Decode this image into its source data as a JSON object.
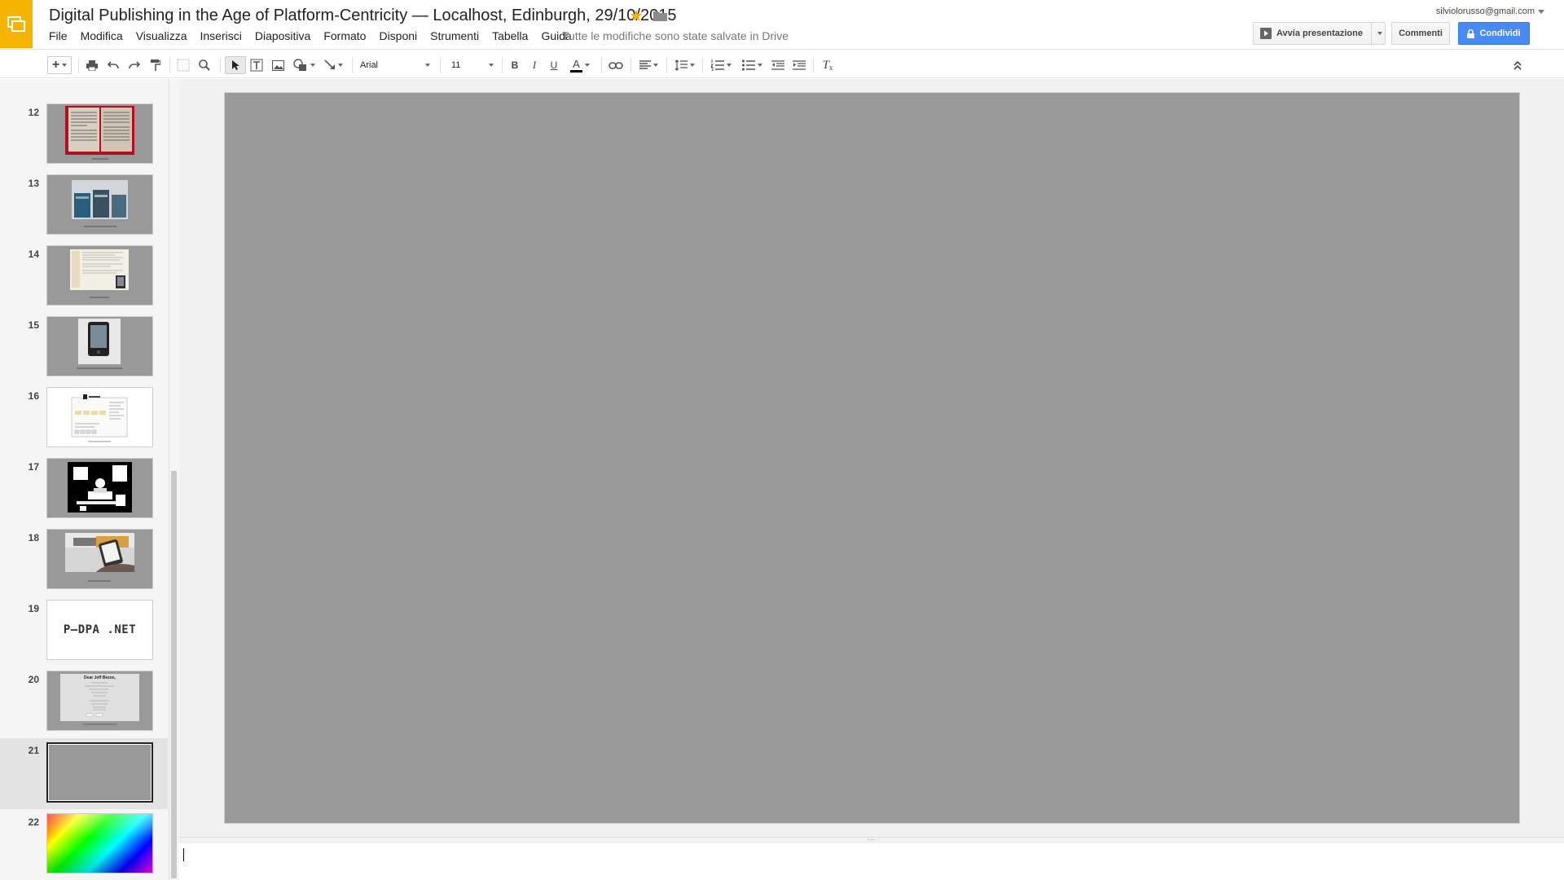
{
  "header": {
    "title": "Digital Publishing in the Age of Platform-Centricity — Localhost, Edinburgh, 29/10/2015",
    "save_status": "Tutte le modifiche sono state salvate in Drive",
    "account": "silviolorusso@gmail.com",
    "present_label": "Avvia presentazione",
    "comments_label": "Commenti",
    "share_label": "Condividi",
    "star_icon": "star-icon",
    "folder_icon": "folder-icon"
  },
  "menu": [
    "File",
    "Modifica",
    "Visualizza",
    "Inserisci",
    "Diapositiva",
    "Formato",
    "Disponi",
    "Strumenti",
    "Tabella",
    "Guida"
  ],
  "toolbar": {
    "add_label": "+",
    "font": "Arial",
    "font_size": "11",
    "bold": "B",
    "italic": "I",
    "underline": "U",
    "text_color": "A",
    "text_color_value": "#000000"
  },
  "slides": [
    {
      "num": "12",
      "desc": "open-book-photo"
    },
    {
      "num": "13",
      "desc": "bookshelf-photo"
    },
    {
      "num": "14",
      "desc": "webpage-screenshot"
    },
    {
      "num": "15",
      "desc": "ereader-photo"
    },
    {
      "num": "16",
      "desc": "diagram"
    },
    {
      "num": "17",
      "desc": "bw-photo"
    },
    {
      "num": "18",
      "desc": "phone-photo"
    },
    {
      "num": "19",
      "text": "P—DPA .NET"
    },
    {
      "num": "20",
      "heading": "Dear Jeff Bezos,"
    },
    {
      "num": "21",
      "desc": "blank-slide",
      "selected": true
    },
    {
      "num": "22",
      "desc": "color-spectrum"
    }
  ],
  "colors": {
    "brand": "#f4b400",
    "share_blue": "#4a8af4",
    "slide_gray": "#999999"
  }
}
